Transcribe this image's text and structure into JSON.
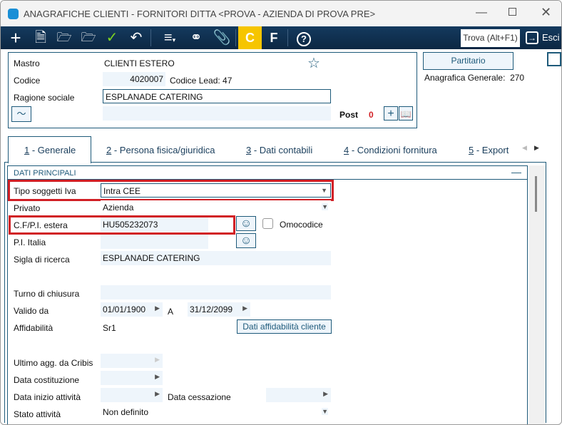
{
  "window": {
    "title": "ANAGRAFICHE CLIENTI - FORNITORI DITTA <PROVA - AZIENDA DI PROVA PRE>"
  },
  "toolbar": {
    "c_label": "C",
    "f_label": "F",
    "search_label": "Trova (Alt+F1)",
    "exit_label": "Esci"
  },
  "header": {
    "mastro_label": "Mastro",
    "mastro_value": "CLIENTI ESTERO",
    "codice_label": "Codice",
    "codice_value": "4020007",
    "codice_lead": "Codice Lead: 47",
    "ragione_label": "Ragione sociale",
    "ragione_value": "ESPLANADE CATERING",
    "post_label": "Post",
    "post_count": "0",
    "partitario_label": "Partitario",
    "anagrafica_generale": "Anagrafica Generale:  270"
  },
  "tabs": [
    {
      "num": "1",
      "label": " - Generale"
    },
    {
      "num": "2",
      "label": " - Persona fisica/giuridica"
    },
    {
      "num": "3",
      "label": " - Dati contabili"
    },
    {
      "num": "4",
      "label": " - Condizioni fornitura"
    },
    {
      "num": "5",
      "label": " - Export"
    }
  ],
  "section": {
    "title": "DATI PRINCIPALI",
    "tipo_label": "Tipo soggetti Iva",
    "tipo_value": "Intra CEE",
    "privato_label": "Privato",
    "privato_value": "Azienda",
    "cf_label": "C.F/P.I. estera",
    "cf_value": "HU505232073",
    "omocodice_label": "Omocodice",
    "pi_label": "P.I. Italia",
    "pi_value": "",
    "sigla_label": "Sigla di ricerca",
    "sigla_value": "ESPLANADE CATERING",
    "turno_label": "Turno di chiusura",
    "turno_value": "",
    "valido_label": "Valido da",
    "valido_da": "01/01/1900",
    "a_label": "A",
    "valido_a": "31/12/2099",
    "affid_label": "Affidabilità",
    "affid_value": "Sr1",
    "affid_button": "Dati affidabilità cliente",
    "cribis_label": "Ultimo agg. da Cribis",
    "costituzione_label": "Data costituzione",
    "inizio_label": "Data inizio attività",
    "cessazione_label": "Data cessazione",
    "stato_label": "Stato attività",
    "stato_value": "Non definito"
  }
}
